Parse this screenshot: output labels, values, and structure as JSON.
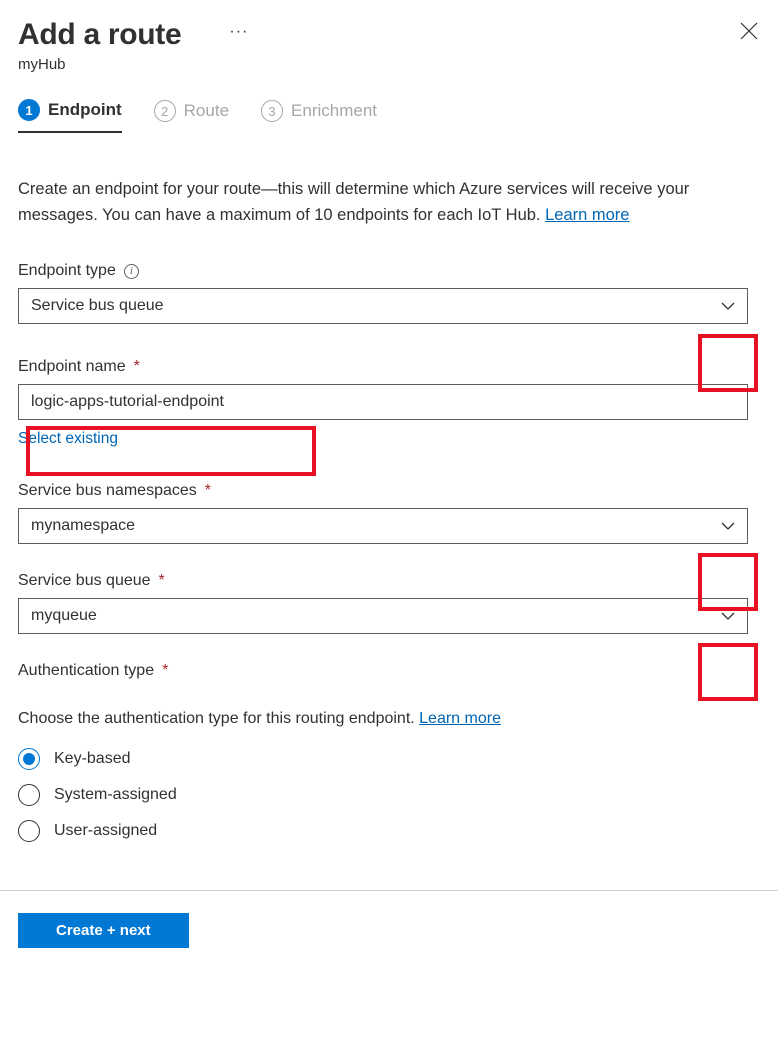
{
  "header": {
    "title": "Add a route",
    "subtitle": "myHub"
  },
  "tabs": [
    {
      "num": "1",
      "label": "Endpoint",
      "active": true
    },
    {
      "num": "2",
      "label": "Route",
      "active": false
    },
    {
      "num": "3",
      "label": "Enrichment",
      "active": false
    }
  ],
  "intro": {
    "text": "Create an endpoint for your route—this will determine which Azure services will receive your messages. You can have a maximum of 10 endpoints for each IoT Hub. ",
    "learn_more": "Learn more"
  },
  "fields": {
    "endpoint_type": {
      "label": "Endpoint type",
      "value": "Service bus queue"
    },
    "endpoint_name": {
      "label": "Endpoint name",
      "value": "logic-apps-tutorial-endpoint",
      "helper": "Select existing"
    },
    "namespace": {
      "label": "Service bus namespaces",
      "value": "mynamespace"
    },
    "queue": {
      "label": "Service bus queue",
      "value": "myqueue"
    },
    "auth_type": {
      "label": "Authentication type"
    }
  },
  "auth": {
    "description": "Choose the authentication type for this routing endpoint. ",
    "learn_more": "Learn more",
    "options": [
      {
        "label": "Key-based",
        "selected": true
      },
      {
        "label": "System-assigned",
        "selected": false
      },
      {
        "label": "User-assigned",
        "selected": false
      }
    ]
  },
  "footer": {
    "primary": "Create + next"
  }
}
